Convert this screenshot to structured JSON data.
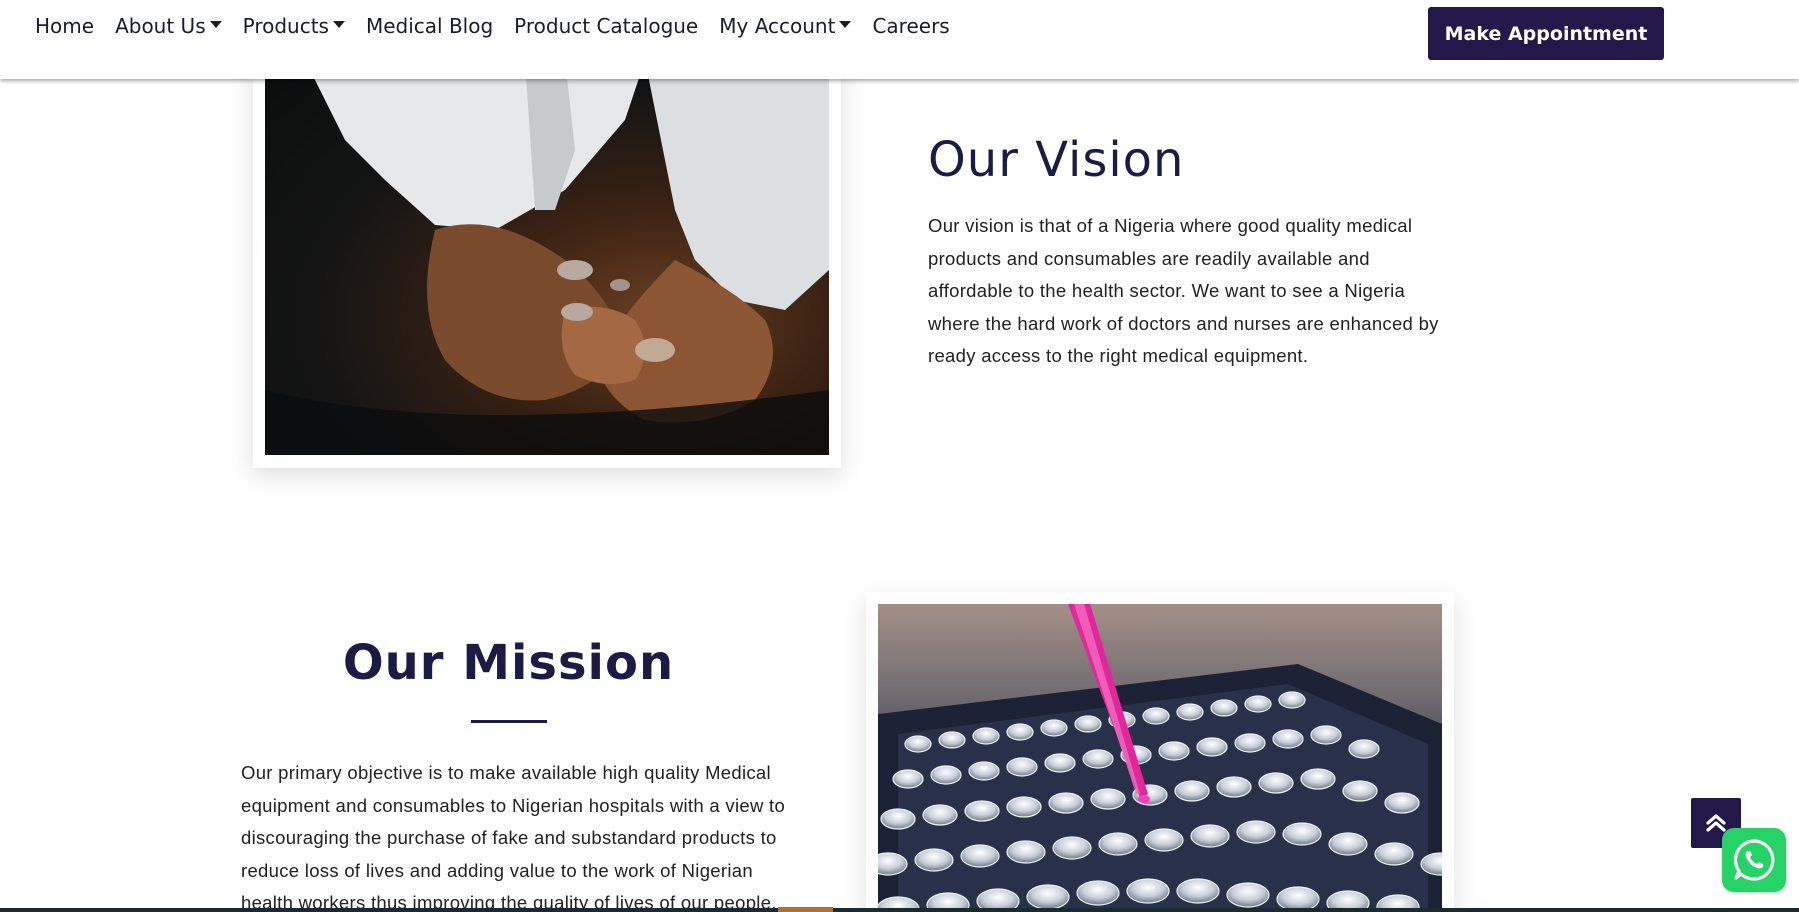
{
  "nav": {
    "items": [
      {
        "label": "Home",
        "dropdown": false
      },
      {
        "label": "About Us",
        "dropdown": true
      },
      {
        "label": "Products",
        "dropdown": true
      },
      {
        "label": "Medical Blog",
        "dropdown": false
      },
      {
        "label": "Product Catalogue",
        "dropdown": false
      },
      {
        "label": "My Account",
        "dropdown": true
      },
      {
        "label": "Careers",
        "dropdown": false
      }
    ],
    "appointment_label": "Make Appointment"
  },
  "vision": {
    "title": "Our Vision",
    "text": "Our vision is that of a Nigeria where good quality medical products and consumables are readily available and affordable to the health sector. We want to see a Nigeria where the hard work of doctors and nurses are enhanced by ready access to the right medical equipment."
  },
  "mission": {
    "title": "Our Mission",
    "text": "Our primary objective is to make available high quality Medical equipment and consumables to Nigerian hospitals with a view to discouraging the purchase of fake and substandard products to reduce loss of lives and adding value to the work of Nigerian health workers thus improving the quality of lives of our people."
  },
  "icons": {
    "scroll_top": "double-chevron-up-icon",
    "whatsapp": "whatsapp-icon"
  },
  "colors": {
    "brand": "#22194a",
    "heading": "#1d1a45",
    "whatsapp": "#25d366"
  }
}
